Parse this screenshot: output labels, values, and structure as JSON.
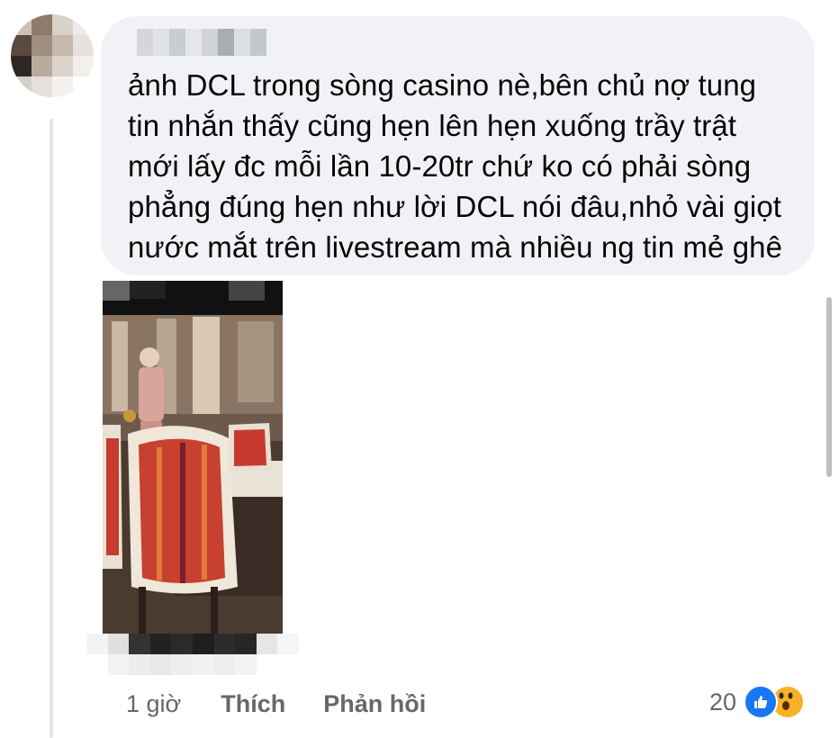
{
  "comment": {
    "text_lines": [
      "ảnh DCL trong sòng casino nè,bên chủ nợ tung",
      "tin nhắn thấy cũng hẹn lên hẹn xuống trầy trật",
      "mới lấy đc mỗi lần 10-20tr chứ ko có phải sòng",
      "phẳng đúng hẹn như lời DCL nói đâu,nhỏ vài giọt",
      "nước mắt trên livestream mà nhiều ng tin mẻ ghê"
    ]
  },
  "actions": {
    "time": "1 giờ",
    "like_label": "Thích",
    "reply_label": "Phản hồi"
  },
  "reactions": {
    "count": "20",
    "icons": [
      "like-icon",
      "wow-icon"
    ]
  },
  "colors": {
    "bubble": "#f0f2f5",
    "secondary_text": "#65676b",
    "like_blue": "#1877f2",
    "wow_yellow": "#f7b125"
  }
}
